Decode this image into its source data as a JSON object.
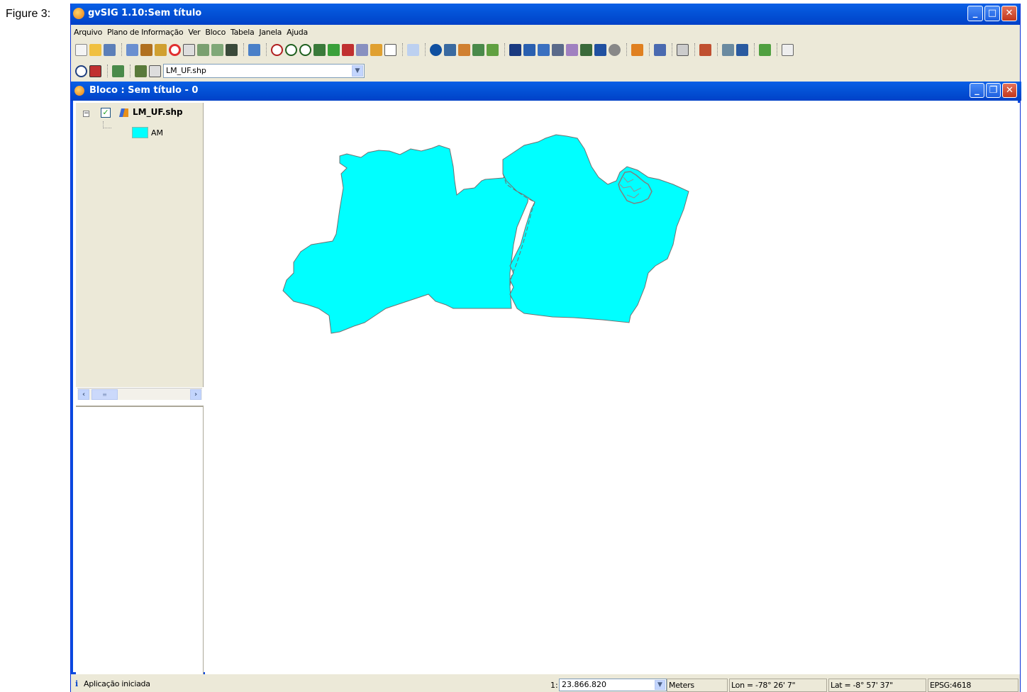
{
  "figure_label": "Figure 3:",
  "app": {
    "title": "gvSIG 1.10:Sem título"
  },
  "menu": [
    "Arquivo",
    "Plano de Informação",
    "Ver",
    "Bloco",
    "Tabela",
    "Janela",
    "Ajuda"
  ],
  "layer_selector": {
    "selected": "LM_UF.shp"
  },
  "view_window": {
    "title": "Bloco : Sem título - 0"
  },
  "toc": {
    "layers": [
      {
        "name": "LM_UF.shp",
        "visible": true,
        "legend": [
          {
            "label": "AM",
            "color": "#00ffff"
          }
        ]
      }
    ]
  },
  "status": {
    "message": "Aplicação iniciada",
    "scale_prefix": "1:",
    "scale": "23.866.820",
    "units": "Meters",
    "lon": "Lon = -78° 26' 7\"",
    "lat": "Lat = -8° 57' 37\"",
    "crs": "EPSG:4618"
  },
  "colors": {
    "title_blue": "#0454d8",
    "fill": "#00ffff",
    "window_bg": "#ece9d8"
  }
}
